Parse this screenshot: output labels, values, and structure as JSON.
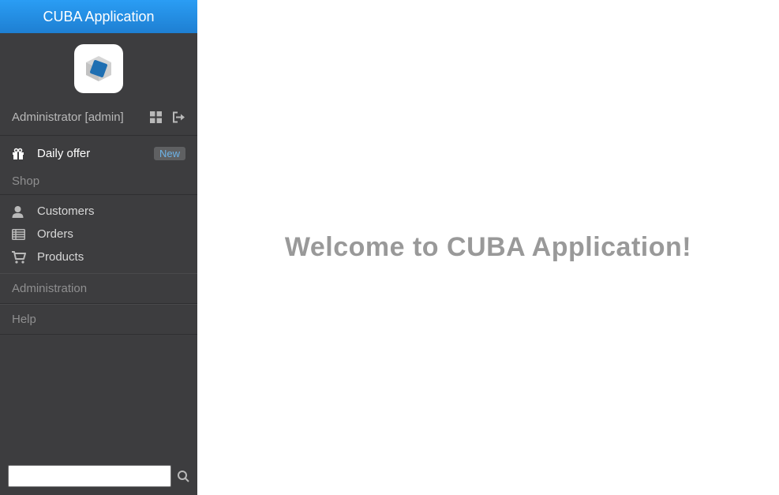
{
  "app": {
    "title": "CUBA Application"
  },
  "user": {
    "display": "Administrator [admin]"
  },
  "nav": {
    "dailyOffer": {
      "label": "Daily offer",
      "badge": "New"
    },
    "sections": {
      "shop": {
        "title": "Shop",
        "items": [
          {
            "label": "Customers"
          },
          {
            "label": "Orders"
          },
          {
            "label": "Products"
          }
        ]
      },
      "administration": {
        "title": "Administration"
      },
      "help": {
        "title": "Help"
      }
    }
  },
  "search": {
    "value": ""
  },
  "main": {
    "welcome": "Welcome to CUBA Application!"
  }
}
